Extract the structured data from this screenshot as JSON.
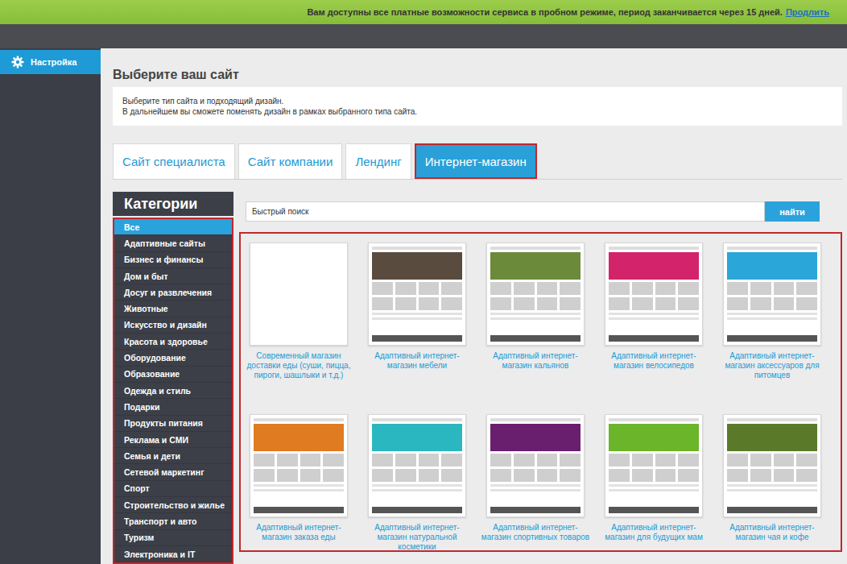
{
  "banner": {
    "text": "Вам доступны все платные возможности сервиса в пробном режиме, период заканчивается через 15 дней.",
    "link": "Продлить"
  },
  "sidebar": {
    "items": [
      {
        "label": "Настройка",
        "selected": true
      }
    ]
  },
  "page": {
    "title": "Выберите ваш сайт",
    "hint": [
      "Выберите тип сайта и подходящий дизайн.",
      "В дальнейшем вы сможете поменять дизайн в рамках выбранного типа сайта."
    ]
  },
  "tabs": [
    {
      "label": "Сайт специалиста",
      "selected": false
    },
    {
      "label": "Сайт компании",
      "selected": false
    },
    {
      "label": "Лендинг",
      "selected": false
    },
    {
      "label": "Интернет-магазин",
      "selected": true
    }
  ],
  "categories": {
    "title": "Категории",
    "items": [
      {
        "label": "Все",
        "selected": true
      },
      {
        "label": "Адаптивные сайты",
        "selected": false
      },
      {
        "label": "Бизнес и финансы",
        "selected": false
      },
      {
        "label": "Дом и быт",
        "selected": false
      },
      {
        "label": "Досуг и развлечения",
        "selected": false
      },
      {
        "label": "Животные",
        "selected": false
      },
      {
        "label": "Искусство и дизайн",
        "selected": false
      },
      {
        "label": "Красота и здоровье",
        "selected": false
      },
      {
        "label": "Оборудование",
        "selected": false
      },
      {
        "label": "Образование",
        "selected": false
      },
      {
        "label": "Одежда и стиль",
        "selected": false
      },
      {
        "label": "Подарки",
        "selected": false
      },
      {
        "label": "Продукты питания",
        "selected": false
      },
      {
        "label": "Реклама и СМИ",
        "selected": false
      },
      {
        "label": "Семья и дети",
        "selected": false
      },
      {
        "label": "Сетевой маркетинг",
        "selected": false
      },
      {
        "label": "Спорт",
        "selected": false
      },
      {
        "label": "Строительство и жилье",
        "selected": false
      },
      {
        "label": "Транспорт и авто",
        "selected": false
      },
      {
        "label": "Туризм",
        "selected": false
      },
      {
        "label": "Электроника и IT",
        "selected": false
      }
    ]
  },
  "search": {
    "placeholder": "Быстрый поиск",
    "button": "найти"
  },
  "templates": [
    {
      "title": "Современный магазин доставки еды (суши, пицца, пироги, шашлыки и т.д.)",
      "kind": "blank",
      "color": "#ffffff"
    },
    {
      "title": "Адаптивный интернет-магазин мебели",
      "kind": "preview",
      "color": "#5a4b3f"
    },
    {
      "title": "Адаптивный интернет-магазин кальянов",
      "kind": "preview",
      "color": "#6b8a3a"
    },
    {
      "title": "Адаптивный интернет-магазин велосипедов",
      "kind": "preview",
      "color": "#d2236b"
    },
    {
      "title": "Адаптивный интернет-магазин аксессуаров для питомцев",
      "kind": "preview",
      "color": "#2aa6d8"
    },
    {
      "title": "Адаптивный интернет-магазин заказа еды",
      "kind": "preview",
      "color": "#e07b22"
    },
    {
      "title": "Адаптивный интернет-магазин натуральной косметики",
      "kind": "preview",
      "color": "#2bb7c0"
    },
    {
      "title": "Адаптивный интернет-магазин спортивных товаров",
      "kind": "preview",
      "color": "#6a1e6e"
    },
    {
      "title": "Адаптивный интернет-магазин для будущих мам",
      "kind": "preview",
      "color": "#6bb52b"
    },
    {
      "title": "Адаптивный интернет-магазин чая и кофе",
      "kind": "preview",
      "color": "#5a7a2a"
    }
  ]
}
